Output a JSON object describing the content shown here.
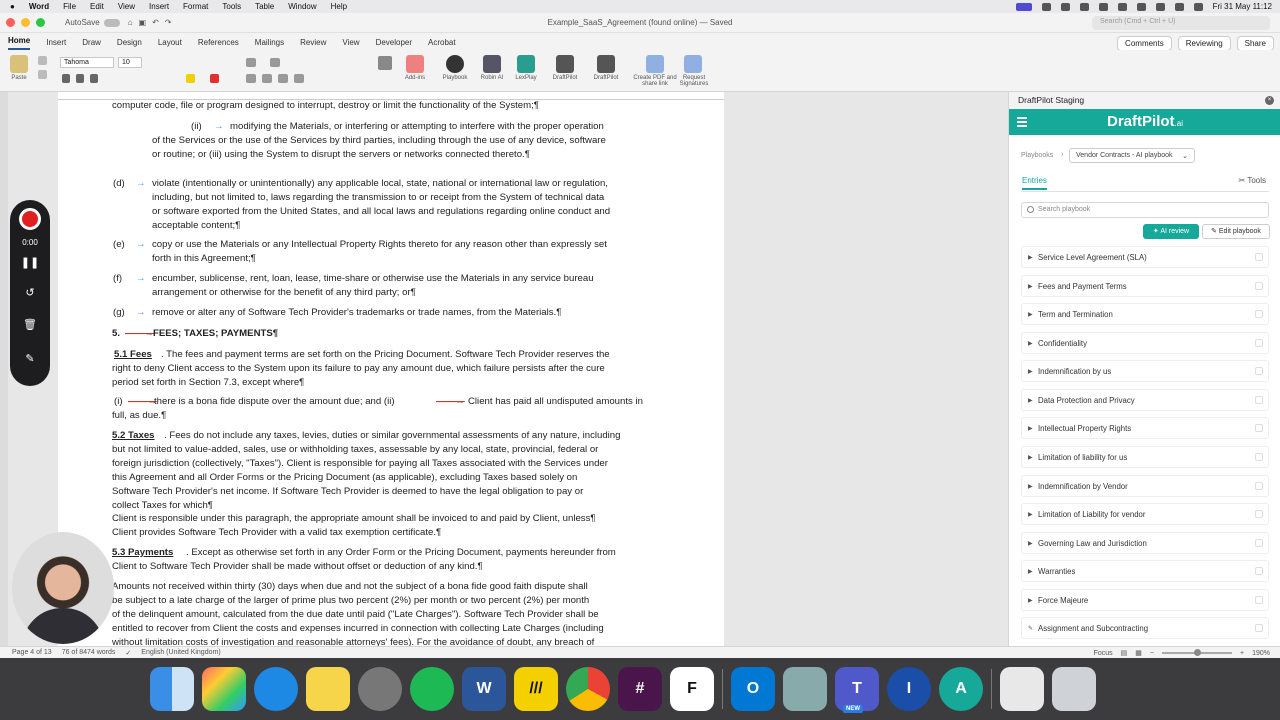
{
  "menubar": {
    "apple": "",
    "items": [
      "Word",
      "File",
      "Edit",
      "View",
      "Insert",
      "Format",
      "Tools",
      "Table",
      "Window",
      "Help"
    ],
    "datetime": "Fri 31 May  11:12"
  },
  "titlebar": {
    "autosave": "AutoSave",
    "doc_title": "Example_SaaS_Agreement (found online)",
    "saved": "— Saved",
    "search_placeholder": "Search (Cmd + Ctrl + U)"
  },
  "ribbon": {
    "tabs": [
      "Home",
      "Insert",
      "Draw",
      "Design",
      "Layout",
      "References",
      "Mailings",
      "Review",
      "View",
      "Developer",
      "Acrobat"
    ],
    "comments": "Comments",
    "reviewing": "Reviewing",
    "share": "Share",
    "paste": "Paste",
    "font": "Tahoma",
    "size": "10",
    "groups": [
      "Add-ins",
      "Playbook",
      "Robin AI",
      "LexPlay",
      "DraftPilot",
      "DraftPilot",
      "Create PDF and share link",
      "Request Signatures"
    ]
  },
  "document": {
    "lines": [
      "computer code, file or program designed to interrupt, destroy or limit the functionality of the System;¶",
      "(ii)",
      "modifying the Materials, or interfering or attempting to interfere with the proper operation",
      "of the Services or the use of the Services by third parties, including through the use of any device, software",
      "or routine; or (iii) using the System to disrupt the servers or networks connected thereto.¶",
      "(d)",
      "violate (intentionally or unintentionally) any applicable local, state, national or international law or regulation,",
      "including, but not limited to, laws regarding the transmission to or receipt from the System of technical data",
      "or software exported from the United States, and all local laws and regulations regarding online conduct and",
      "acceptable content;¶",
      "(e)",
      "copy or use the Materials or any Intellectual Property Rights thereto for any reason other than expressly set",
      "forth in this Agreement;¶",
      "(f)",
      "encumber, sublicense, rent, loan, lease, time-share or otherwise use the Materials in any service bureau",
      "arrangement or otherwise for the benefit of any third party; or¶",
      "(g)",
      "remove or alter any of Software Tech Provider's trademarks or trade names, from the Materials.¶",
      "5.",
      "FEES; TAXES; PAYMENTS¶",
      "5.1 Fees",
      ". The fees and payment terms are set forth on the Pricing Document. Software Tech Provider reserves the",
      "right to deny Client access to the System upon its failure to pay any amount due, which failure persists after the cure",
      "period set forth in Section 7.3, except where¶",
      "(i)",
      "there is a bona fide dispute over the amount due; and (ii)",
      "Client has paid all undisputed amounts in",
      "full, as due.¶",
      "5.2 Taxes",
      ". Fees do not include any taxes, levies, duties or similar governmental assessments of any nature, including",
      "but not limited to value-added, sales, use or withholding taxes, assessable by any local, state, provincial, federal or",
      "foreign jurisdiction (collectively, \"Taxes\"). Client is responsible for paying all Taxes associated with the Services under",
      "this Agreement and all Order Forms or the Pricing Document (as applicable), excluding Taxes based solely on",
      "Software Tech Provider's net income. If Software Tech Provider is deemed to have the legal obligation to pay or",
      "collect Taxes for which¶",
      "Client is responsible under this paragraph, the appropriate amount shall be invoiced to and paid by Client, unless¶",
      "Client provides Software Tech Provider with a valid tax exemption certificate.¶",
      "5.3 Payments",
      ". Except as otherwise set forth in any Order Form or the Pricing Document, payments hereunder from",
      "Client to Software Tech Provider shall be made without offset or deduction of any kind.¶",
      "Amounts not received within thirty (30) days when due and not the subject of a bona fide good faith dispute shall",
      "be subject to a late charge of the larger of prime plus two percent (2%) per month or two percent (2%) per month",
      "of the delinquent amount, calculated from the due date until paid (\"Late Charges\"). Software Tech Provider shall be",
      "entitled to recover from Client the costs and expenses incurred in connection with collecting Late Charges (including",
      "without limitation costs of investigation and reasonable attorneys' fees). For the avoidance of doubt, any breach of"
    ]
  },
  "recorder": {
    "time": "0:00"
  },
  "statusbar": {
    "page": "Page 4 of 13",
    "words": "76 of 8474 words",
    "language": "English (United Kingdom)",
    "focus": "Focus",
    "zoom": "190%"
  },
  "panel": {
    "title": "DraftPilot Staging",
    "brand": "DraftPilot",
    "brand_suffix": ".ai",
    "breadcrumb": "Playbooks",
    "playbook": "Vendor Contracts - AI playbook",
    "tab_entries": "Entries",
    "tab_tools": "Tools",
    "search_placeholder": "Search playbook",
    "ai_review": "AI review",
    "edit_playbook": "Edit playbook",
    "entries": [
      "Service Level Agreement (SLA)",
      "Fees and Payment Terms",
      "Term and Termination",
      "Confidentiality",
      "Indemnification by us",
      "Data Protection and Privacy",
      "Intellectual Property Rights",
      "Limitation of liability for us",
      "Indemnification by Vendor",
      "Limitation of Liability for vendor",
      "Governing Law and Jurisdiction",
      "Warranties",
      "Force Majeure",
      "Assignment and Subcontracting"
    ]
  },
  "dock": {
    "new_badge": "NEW",
    "word_letter": "W"
  }
}
